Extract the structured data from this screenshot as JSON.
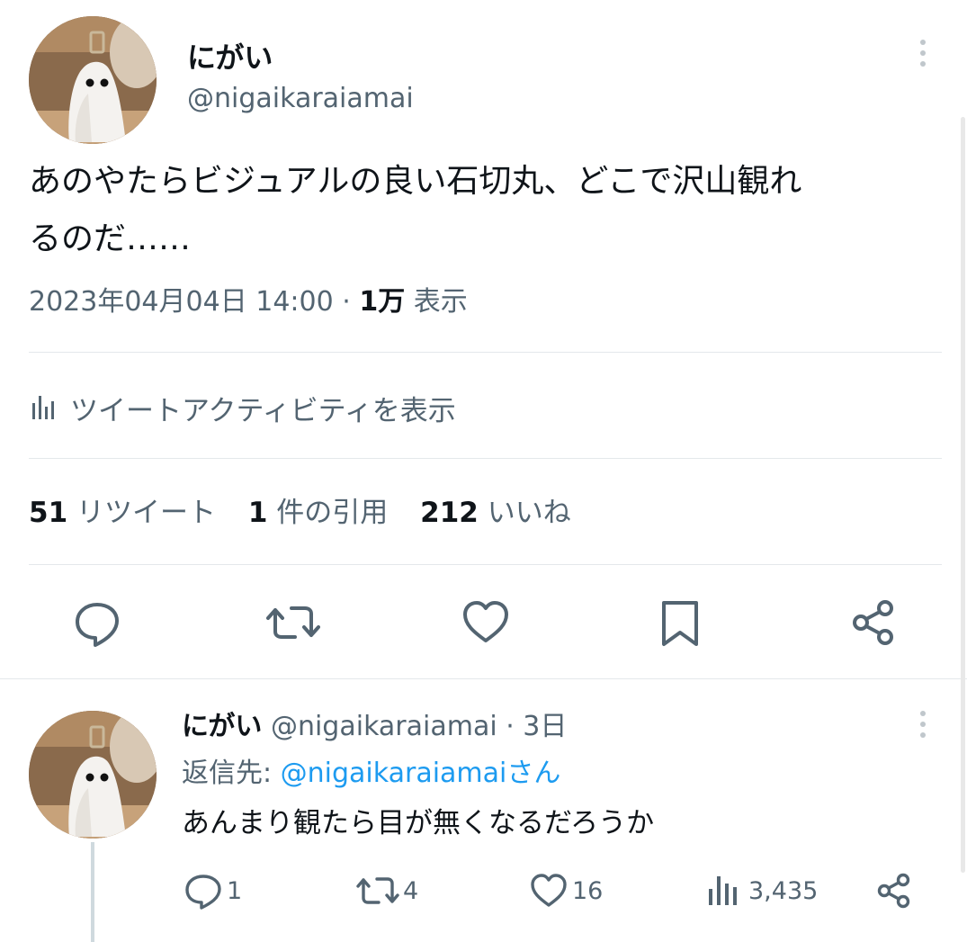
{
  "main_tweet": {
    "display_name": "にがい",
    "handle": "@nigaikaraiamai",
    "text_line1": "あのやたらビジュアルの良い石切丸、どこで沢山観れ",
    "text_line2": "るのだ……",
    "timestamp": "2023年04月04日 14:00",
    "separator": "·",
    "views_count": "1万",
    "views_label": "表示",
    "activity_label": "ツイートアクティビティを表示",
    "stats": {
      "retweets_count": "51",
      "retweets_label": "リツイート",
      "quotes_count": "1",
      "quotes_label": "件の引用",
      "likes_count": "212",
      "likes_label": "いいね"
    }
  },
  "reply_tweet": {
    "display_name": "にがい",
    "handle": "@nigaikaraiamai",
    "time": "· 3日",
    "reply_to_prefix": "返信先:",
    "reply_to_handle": "@nigaikaraiamaiさん",
    "text": "あんまり観たら目が無くなるだろうか",
    "counts": {
      "replies": "1",
      "retweets": "4",
      "likes": "16",
      "views": "3,435"
    }
  },
  "icons": {
    "reply": "speech-bubble-icon",
    "retweet": "retweet-arrows-icon",
    "like": "heart-icon",
    "bookmark": "bookmark-icon",
    "share": "share-icon",
    "analytics": "bar-chart-icon",
    "more": "more-vertical-icon"
  },
  "colors": {
    "link": "#1d9bf0",
    "text": "#0f1419",
    "secondary": "#536471"
  }
}
